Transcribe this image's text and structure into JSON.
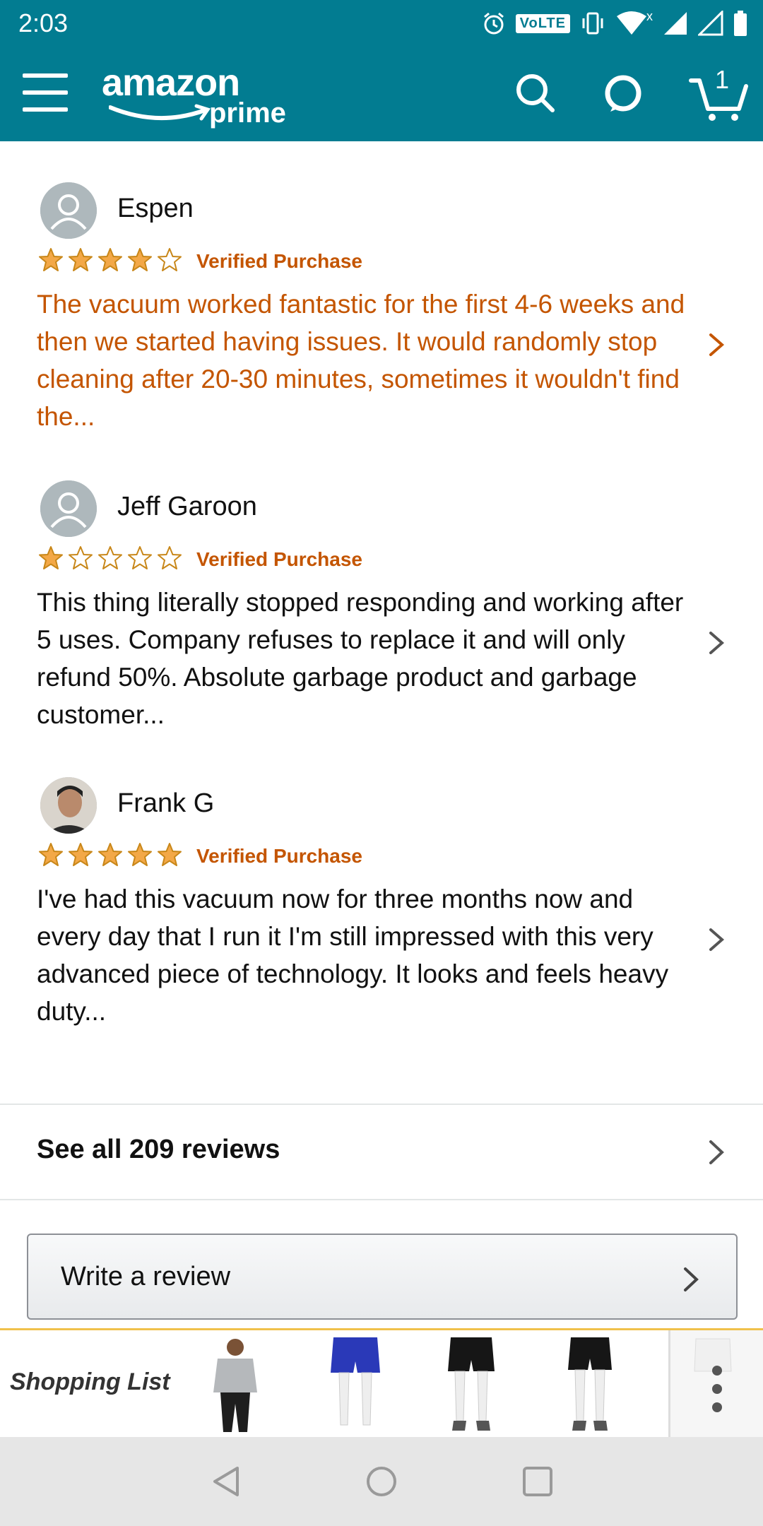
{
  "status_bar": {
    "time": "2:03",
    "volte": "VoLTE",
    "wifi_marker": "x"
  },
  "app_bar": {
    "logo_main": "amazon",
    "logo_sub": "prime",
    "cart_count": "1",
    "brand_color": "#027c91"
  },
  "reviews": [
    {
      "author": "Espen",
      "rating": 4,
      "badge": "Verified Purchase",
      "text": "The vacuum worked fantastic for the first 4-6 weeks and then we started having issues. It would randomly stop cleaning after 20-30 minutes, sometimes it wouldn't find the...",
      "highlighted": true
    },
    {
      "author": "Jeff Garoon",
      "rating": 1,
      "badge": "Verified Purchase",
      "text": "This thing literally stopped responding and working after 5 uses. Company refuses to replace it and will only refund 50%. Absolute garbage product and garbage customer...",
      "highlighted": false
    },
    {
      "author": "Frank G",
      "rating": 5,
      "badge": "Verified Purchase",
      "text": "I've had this vacuum now for three months now and every day that I run it I'm still impressed with this very advanced piece of technology. It looks and feels heavy duty...",
      "highlighted": false
    }
  ],
  "see_all": {
    "label": "See all 209 reviews"
  },
  "write_review": {
    "label": "Write a review"
  },
  "shopping_list": {
    "label": "Shopping List",
    "items": [
      "gray-tshirt",
      "blue-shorts",
      "black-shorts",
      "black-shorts-2",
      "white-item"
    ]
  },
  "colors": {
    "accent_orange": "#c45500",
    "star_gold": "#f3a847",
    "divider": "#e3e6e6"
  }
}
